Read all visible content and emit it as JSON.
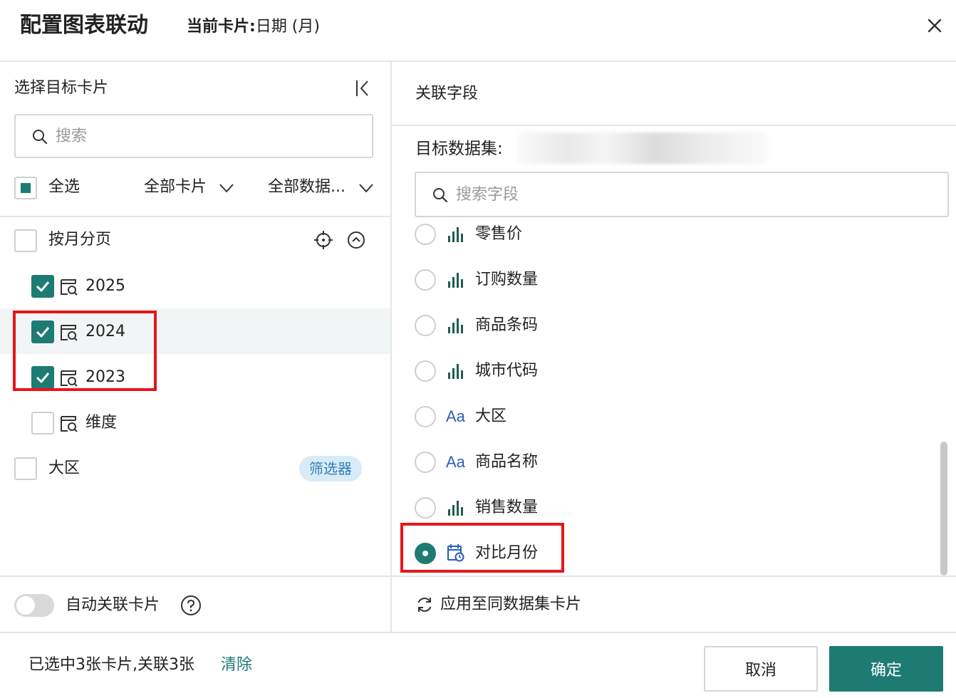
{
  "header": {
    "title": "配置图表联动",
    "current_card_label": "当前卡片:",
    "current_card_value": "日期 (月)"
  },
  "left": {
    "title": "选择目标卡片",
    "search_placeholder": "搜索",
    "select_all": "全选",
    "filter_cards": "全部卡片",
    "filter_data": "全部数据...",
    "group_label": "按月分页",
    "items": [
      {
        "label": "2025",
        "checked": true
      },
      {
        "label": "2024",
        "checked": true
      },
      {
        "label": "2023",
        "checked": true
      },
      {
        "label": "维度",
        "checked": false
      }
    ],
    "region_label": "大区",
    "region_badge": "筛选器",
    "auto_link": "自动关联卡片"
  },
  "right": {
    "title": "关联字段",
    "dataset_label": "目标数据集:",
    "search_placeholder": "搜索字段",
    "fields": [
      {
        "label": "零售价",
        "type": "measure",
        "selected": false
      },
      {
        "label": "订购数量",
        "type": "measure",
        "selected": false
      },
      {
        "label": "商品条码",
        "type": "measure",
        "selected": false
      },
      {
        "label": "城市代码",
        "type": "measure",
        "selected": false
      },
      {
        "label": "大区",
        "type": "text",
        "selected": false
      },
      {
        "label": "商品名称",
        "type": "text",
        "selected": false
      },
      {
        "label": "销售数量",
        "type": "measure",
        "selected": false
      },
      {
        "label": "对比月份",
        "type": "date",
        "selected": true
      }
    ],
    "text_icon": "Aa",
    "apply_same": "应用至同数据集卡片"
  },
  "footer": {
    "selection_info": "已选中3张卡片,关联3张",
    "clear": "清除",
    "cancel": "取消",
    "ok": "确定"
  },
  "colors": {
    "accent": "#1e7b73",
    "highlight": "#e8151b",
    "text_icon": "#2a5db8"
  }
}
